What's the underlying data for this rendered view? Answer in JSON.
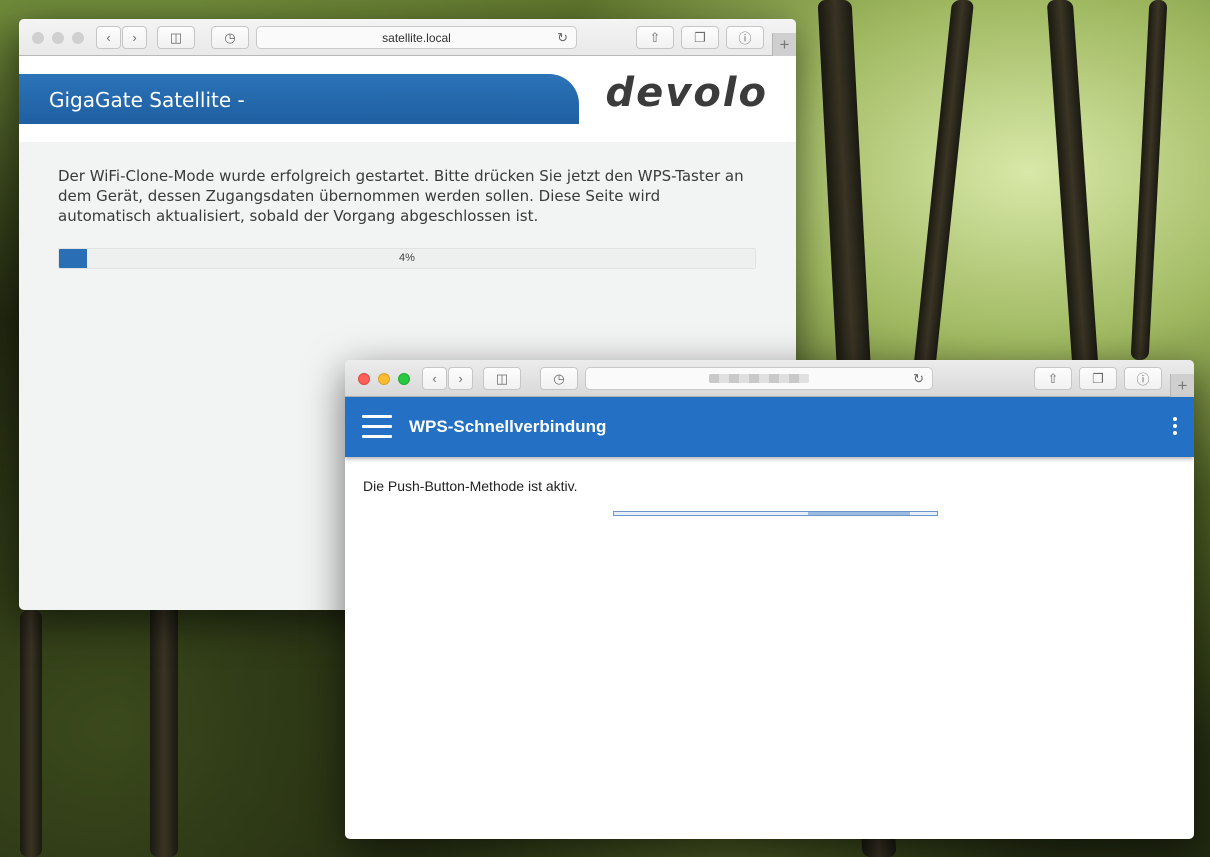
{
  "back_window": {
    "url": "satellite.local",
    "banner_title": "GigaGate Satellite -",
    "logo": "devolo",
    "message": "Der WiFi-Clone-Mode wurde erfolgreich gestartet. Bitte drücken Sie jetzt den WPS-Taster an dem Gerät, dessen Zugangsdaten übernommen werden sollen. Diese Seite wird automatisch aktualisiert, sobald der Vorgang abgeschlossen ist.",
    "progress": {
      "value": 4,
      "label": "4%"
    },
    "accent_color": "#2a6eb6"
  },
  "front_window": {
    "url": "",
    "header_title": "WPS-Schnellverbindung",
    "message": "Die Push-Button-Methode ist aktiv.",
    "header_color": "#2370c4"
  },
  "toolbar": {
    "icons": [
      "back-icon",
      "forward-icon",
      "sidebar-icon",
      "history-icon",
      "reload-icon",
      "share-icon",
      "tabs-icon",
      "info-icon",
      "new-tab-icon"
    ],
    "new_tab_symbol": "+"
  }
}
